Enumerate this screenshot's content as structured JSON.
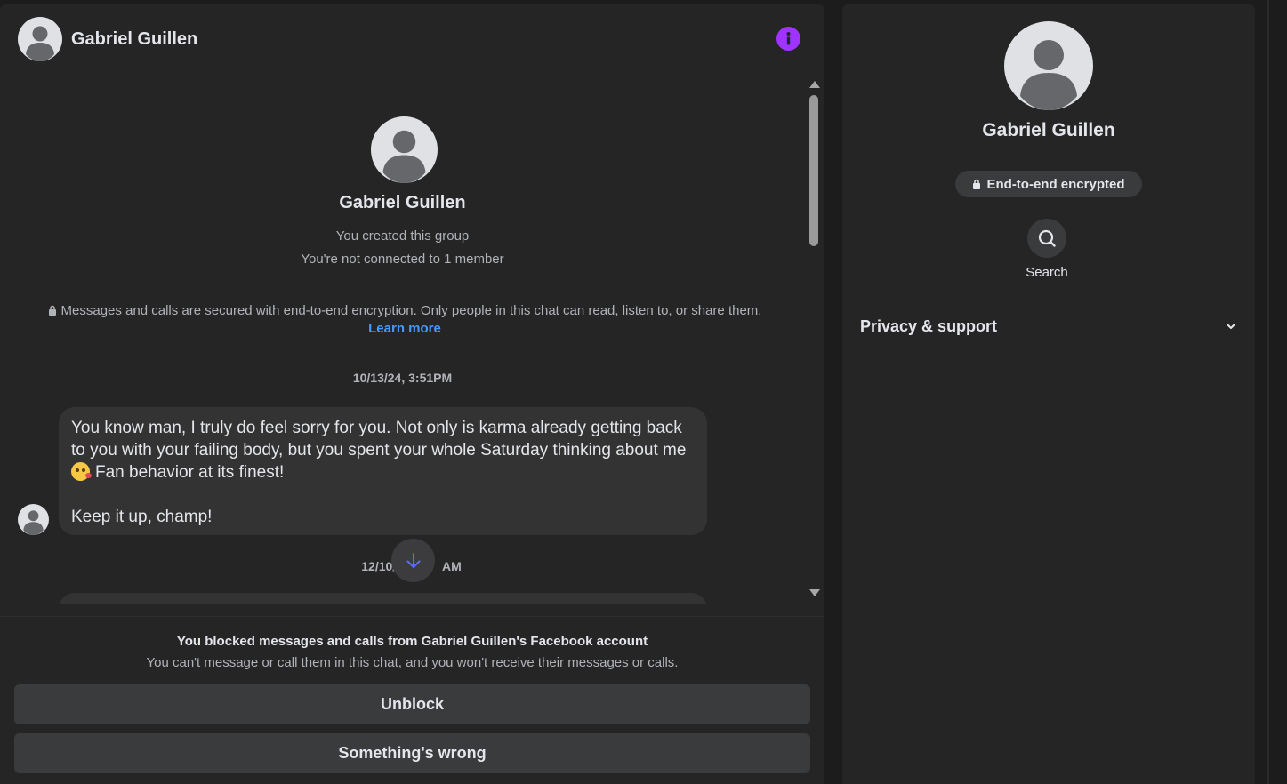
{
  "header": {
    "contact_name": "Gabriel Guillen",
    "info_icon": "info-icon",
    "accent_color": "#a033ff"
  },
  "intro": {
    "name": "Gabriel Guillen",
    "line1": "You created this group",
    "line2": "You're not connected to 1 member",
    "encryption_note": "Messages and calls are secured with end-to-end encryption. Only people in this chat can read, listen to, or share them.",
    "learn_more": "Learn more"
  },
  "messages": [
    {
      "timestamp": "10/13/24, 3:51PM",
      "line1": "You know man, I truly do feel sorry for you. Not only is karma already getting back to you with your failing body, but you spent your whole Saturday thinking about me",
      "line2": "Fan behavior at its finest!",
      "line3": "Keep it up, champ!"
    },
    {
      "timestamp_left": "12/10/2",
      "timestamp_right": "AM"
    }
  ],
  "blocked": {
    "title": "You blocked messages and calls from Gabriel Guillen's Facebook account",
    "subtitle": "You can't message or call them in this chat, and you won't receive their messages or calls.",
    "unblock_label": "Unblock",
    "wrong_label": "Something's wrong"
  },
  "side": {
    "name": "Gabriel Guillen",
    "badge": "End-to-end encrypted",
    "search_label": "Search",
    "privacy_label": "Privacy & support"
  }
}
